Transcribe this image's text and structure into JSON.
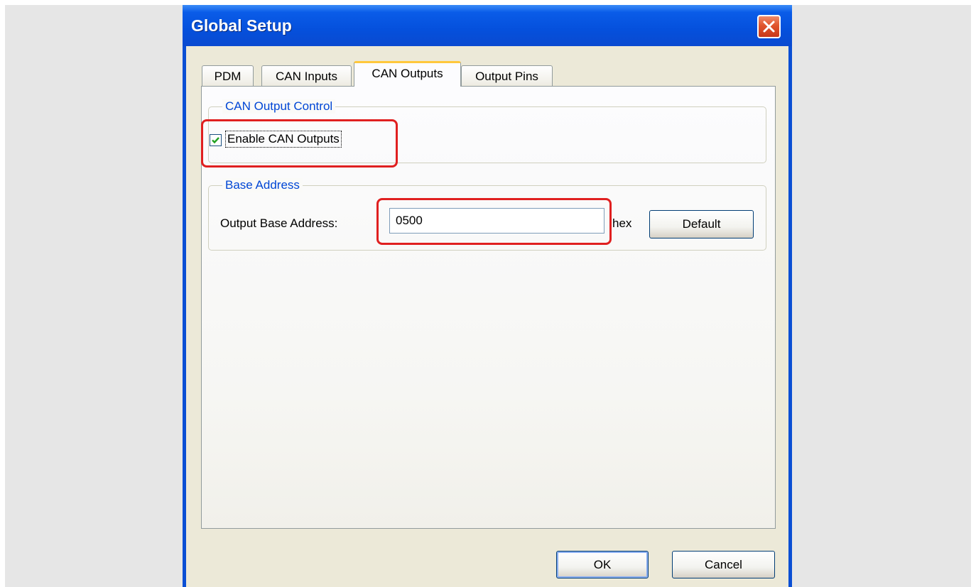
{
  "dialog": {
    "title": "Global Setup"
  },
  "tabs": [
    {
      "label": "PDM",
      "active": false
    },
    {
      "label": "CAN Inputs",
      "active": false
    },
    {
      "label": "CAN Outputs",
      "active": true
    },
    {
      "label": "Output Pins",
      "active": false
    }
  ],
  "can_output_control": {
    "group_label": "CAN Output Control",
    "checkbox_label": "Enable CAN Outputs",
    "checked": true
  },
  "base_address": {
    "group_label": "Base Address",
    "field_label": "Output Base Address:",
    "value": "0500",
    "unit_label": "hex",
    "default_button_label": "Default"
  },
  "buttons": {
    "ok_label": "OK",
    "cancel_label": "Cancel"
  },
  "colors": {
    "titlebar": "#0550dc",
    "group_label": "#0046d5",
    "highlight": "#e02020",
    "active_tab_accent": "#ffc83c"
  },
  "icons": {
    "close": "close-icon",
    "check": "checkmark-icon"
  }
}
